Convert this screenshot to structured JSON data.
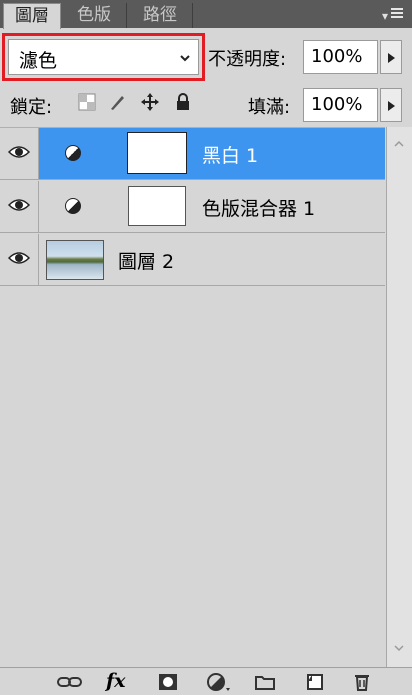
{
  "tabs": [
    {
      "label": "圖層",
      "active": true
    },
    {
      "label": "色版",
      "active": false
    },
    {
      "label": "路徑",
      "active": false
    }
  ],
  "panel_menu_icon": "panel-menu-icon",
  "blend_mode": {
    "value": "濾色",
    "highlight_color": "#e11d23"
  },
  "opacity": {
    "label": "不透明度:",
    "value": "100%"
  },
  "lock": {
    "label": "鎖定:",
    "icons": [
      "lock-transparent-icon",
      "lock-paint-icon",
      "lock-move-icon",
      "lock-all-icon"
    ]
  },
  "fill": {
    "label": "填滿:",
    "value": "100%"
  },
  "layers": [
    {
      "name": "黑白 1",
      "type": "adjustment",
      "selected": true,
      "visible": true
    },
    {
      "name": "色版混合器 1",
      "type": "adjustment",
      "selected": false,
      "visible": true
    },
    {
      "name": "圖層 2",
      "type": "image",
      "selected": false,
      "visible": true
    }
  ],
  "colors": {
    "selection": "#3d95f0",
    "panel": "#d6d6d6",
    "tabbar": "#5a5a5a"
  },
  "toolbar_icons": [
    "link-layers-icon",
    "fx-icon",
    "add-mask-icon",
    "adjustment-layer-icon",
    "new-group-icon",
    "new-layer-icon",
    "trash-icon"
  ],
  "fx_text": "fx"
}
